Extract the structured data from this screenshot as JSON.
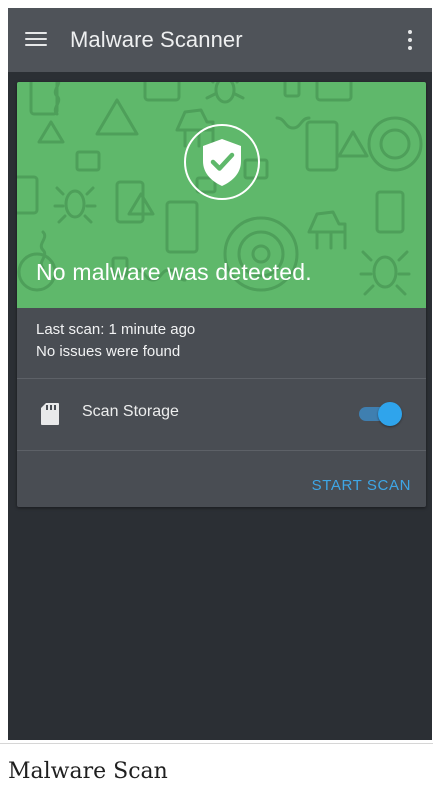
{
  "appbar": {
    "title": "Malware Scanner",
    "menu_icon": "hamburger-menu-icon",
    "overflow_icon": "more-vert-icon",
    "background_color": "#4f5359"
  },
  "status_card": {
    "banner_color": "#5fb86b",
    "status_icon": "shield-check-icon",
    "headline": "No malware was detected.",
    "last_scan": "Last scan: 1 minute ago",
    "issues_text": "No issues were found",
    "scan_storage": {
      "icon": "sd-card-icon",
      "label": "Scan Storage",
      "enabled": true
    },
    "action_label": "START SCAN",
    "accent_color": "#3ea6e6"
  },
  "caption": "Malware Scan"
}
